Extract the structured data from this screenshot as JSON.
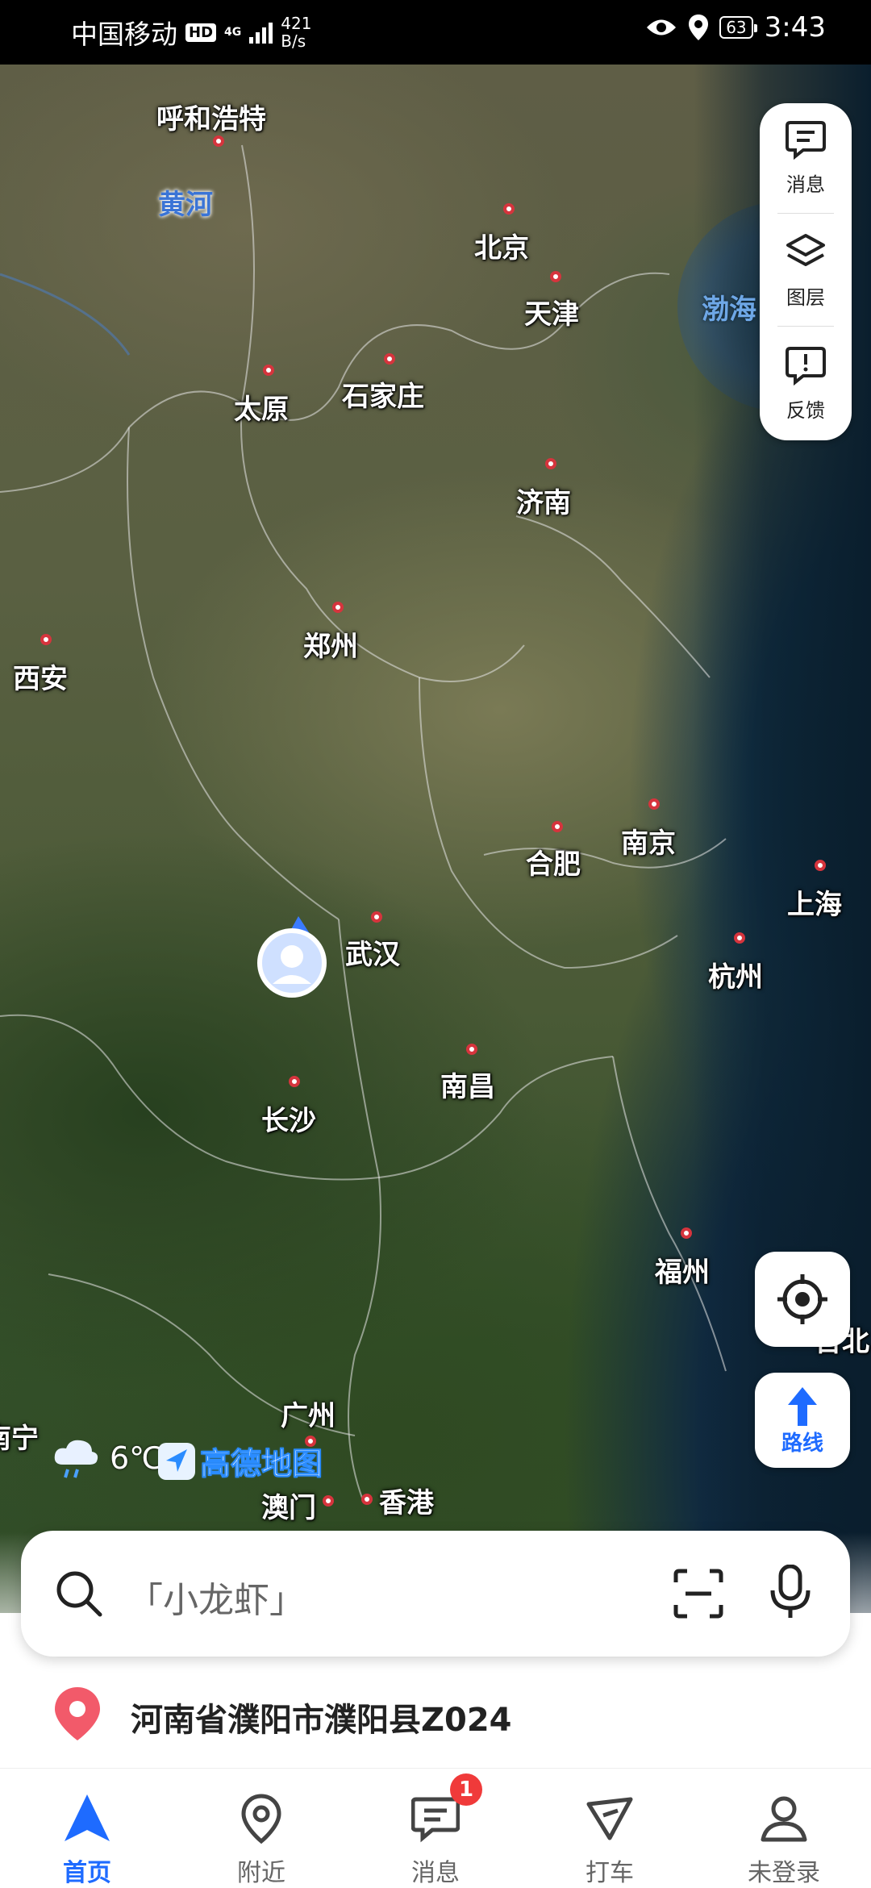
{
  "status_bar": {
    "carrier": "中国移动",
    "hd": "HD",
    "network": "4G",
    "speed_value": "421",
    "speed_unit": "B/s",
    "battery": "63",
    "time": "3:43"
  },
  "map": {
    "cities": [
      {
        "id": "hohhot",
        "name": "呼和浩特"
      },
      {
        "id": "beijing",
        "name": "北京"
      },
      {
        "id": "tianjin",
        "name": "天津"
      },
      {
        "id": "taiyuan",
        "name": "太原"
      },
      {
        "id": "shijiazhuang",
        "name": "石家庄"
      },
      {
        "id": "jinan",
        "name": "济南"
      },
      {
        "id": "zhengzhou",
        "name": "郑州"
      },
      {
        "id": "xian",
        "name": "西安"
      },
      {
        "id": "hefei",
        "name": "合肥"
      },
      {
        "id": "nanjing",
        "name": "南京"
      },
      {
        "id": "shanghai",
        "name": "上海"
      },
      {
        "id": "wuhan",
        "name": "武汉"
      },
      {
        "id": "hangzhou",
        "name": "杭州"
      },
      {
        "id": "nanchang",
        "name": "南昌"
      },
      {
        "id": "changsha",
        "name": "长沙"
      },
      {
        "id": "fuzhou",
        "name": "福州"
      },
      {
        "id": "guangzhou",
        "name": "广州"
      },
      {
        "id": "macau",
        "name": "澳门"
      },
      {
        "id": "hongkong",
        "name": "香港"
      }
    ],
    "river_label": "黄河",
    "sea_label": "渤海",
    "edge_label_left": "南宁",
    "edge_label_right": "台北"
  },
  "controls": {
    "messages": "消息",
    "layers": "图层",
    "feedback": "反馈",
    "route": "路线"
  },
  "weather": {
    "temp": "6℃",
    "icon": "rain-cloud-icon"
  },
  "brand": {
    "name": "高德地图"
  },
  "search": {
    "placeholder": "「小龙虾」"
  },
  "location": {
    "address": "河南省濮阳市濮阳县Z024"
  },
  "tabs": [
    {
      "label": "首页",
      "icon": "navigation-arrow-icon",
      "active": true
    },
    {
      "label": "附近",
      "icon": "location-pin-icon",
      "active": false
    },
    {
      "label": "消息",
      "icon": "message-icon",
      "active": false,
      "badge": "1"
    },
    {
      "label": "打车",
      "icon": "taxi-icon",
      "active": false
    },
    {
      "label": "未登录",
      "icon": "user-icon",
      "active": false
    }
  ],
  "colors": {
    "accent": "#1e6bff",
    "badge": "#f03a3a",
    "city_dot": "#d6343d",
    "river_label": "#3a74d6"
  }
}
